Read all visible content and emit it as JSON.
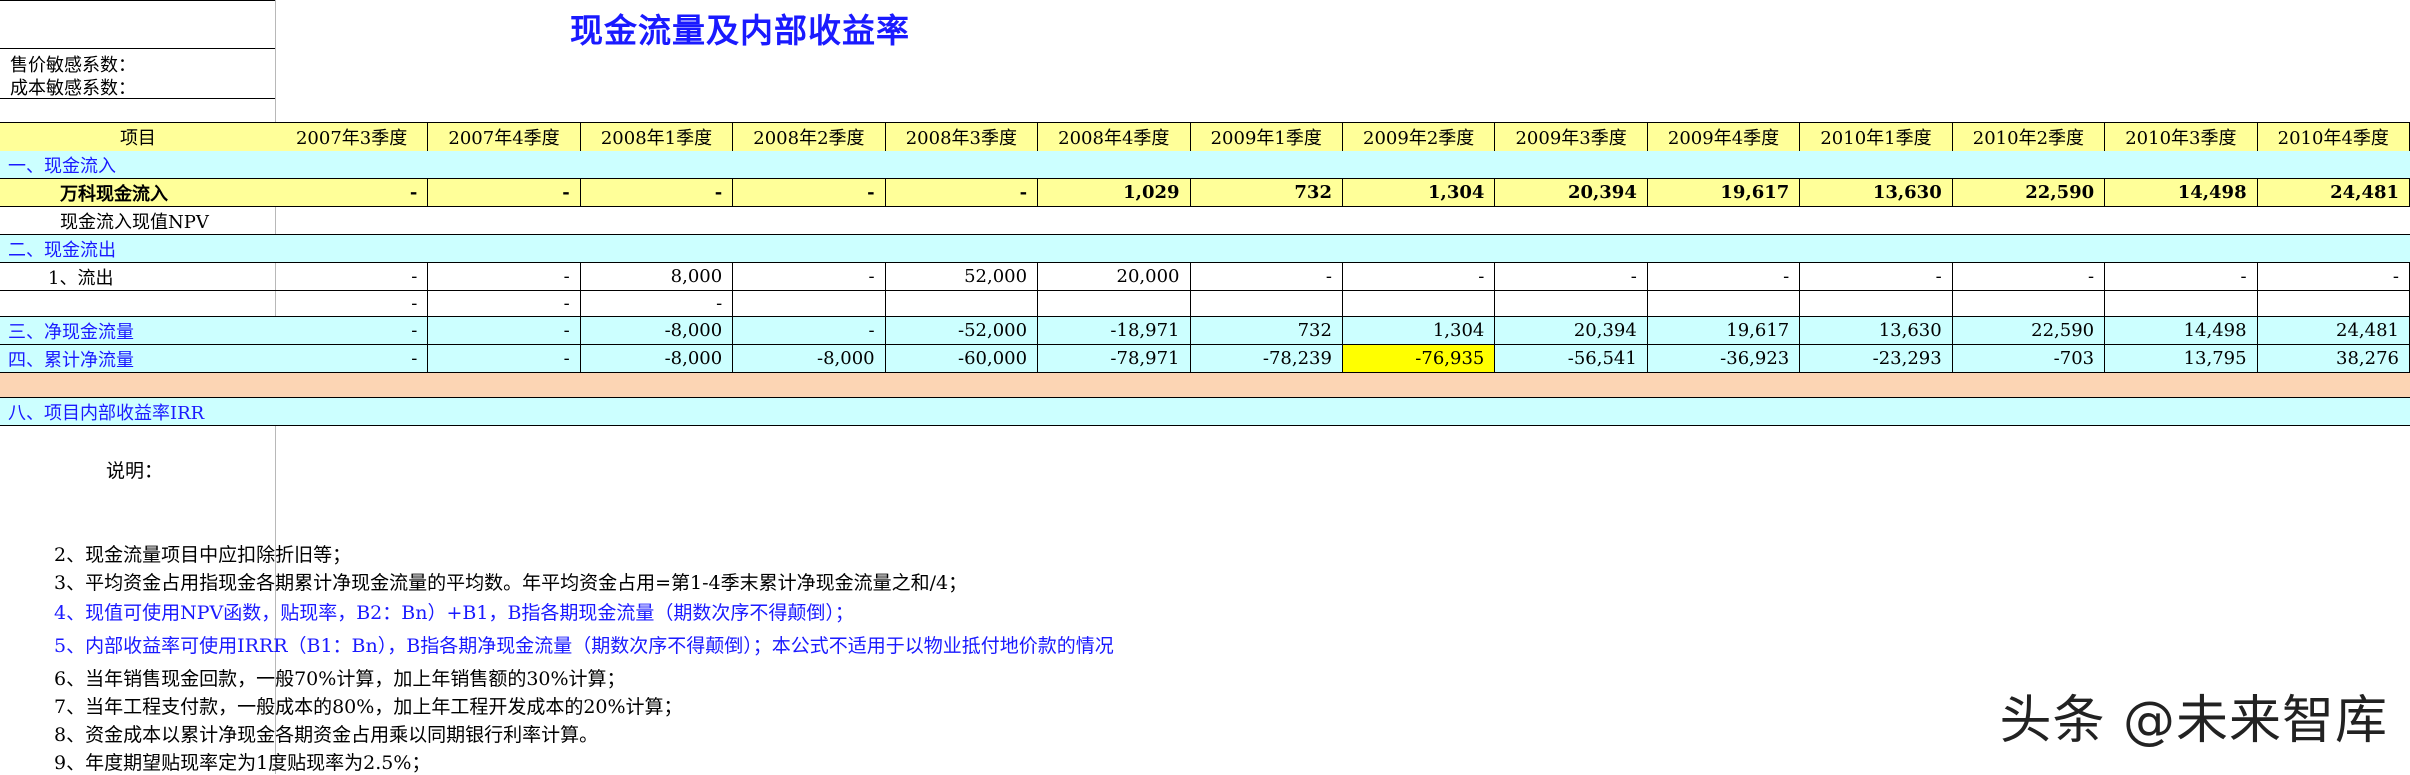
{
  "title": "现金流量及内部收益率",
  "side_labels": [
    "售价敏感系数：",
    "成本敏感系数："
  ],
  "header": {
    "item": "项目",
    "periods": [
      "2007年3季度",
      "2007年4季度",
      "2008年1季度",
      "2008年2季度",
      "2008年3季度",
      "2008年4季度",
      "2009年1季度",
      "2009年2季度",
      "2009年3季度",
      "2009年4季度",
      "2010年1季度",
      "2010年2季度",
      "2010年3季度",
      "2010年4季度"
    ]
  },
  "rows": [
    {
      "label": "一、现金流入",
      "values": []
    },
    {
      "label": "万科现金流入",
      "values": [
        "-",
        "-",
        "-",
        "-",
        "-",
        "1,029",
        "732",
        "1,304",
        "20,394",
        "19,617",
        "13,630",
        "22,590",
        "14,498",
        "24,481"
      ]
    },
    {
      "label": "现金流入现值NPV",
      "values": []
    },
    {
      "label": "二、现金流出",
      "values": []
    },
    {
      "label": "1、流出",
      "values": [
        "-",
        "-",
        "8,000",
        "-",
        "52,000",
        "20,000",
        "-",
        "-",
        "-",
        "-",
        "-",
        "-",
        "-",
        "-"
      ]
    },
    {
      "label": "",
      "values": [
        "-",
        "-",
        "-",
        "",
        "",
        "",
        "",
        "",
        "",
        "",
        "",
        "",
        "",
        ""
      ]
    },
    {
      "label": "三、净现金流量",
      "values": [
        "-",
        "-",
        "-8,000",
        "-",
        "-52,000",
        "-18,971",
        "732",
        "1,304",
        "20,394",
        "19,617",
        "13,630",
        "22,590",
        "14,498",
        "24,481"
      ]
    },
    {
      "label": "四、累计净流量",
      "values": [
        "-",
        "-",
        "-8,000",
        "-8,000",
        "-60,000",
        "-78,971",
        "-78,239",
        "-76,935",
        "-56,541",
        "-36,923",
        "-23,293",
        "-703",
        "13,795",
        "38,276"
      ]
    },
    {
      "label": "",
      "values": []
    },
    {
      "label": "八、项目内部收益率IRR",
      "values": []
    }
  ],
  "notes_title": "说明：",
  "notes": [
    "2、现金流量项目中应扣除折旧等；",
    "3、平均资金占用指现金各期累计净现金流量的平均数。年平均资金占用=第1-4季末累计净现金流量之和/4；",
    "4、现值可使用NPV函数，贴现率，B2：Bn）+B1，B指各期现金流量（期数次序不得颠倒）；",
    "5、内部收益率可使用IRRR（B1：Bn），B指各期净现金流量（期数次序不得颠倒）；本公式不适用于以物业抵付地价款的情况",
    "6、当年销售现金回款，一般70%计算，加上年销售额的30%计算；",
    "7、当年工程支付款，一般成本的80%，加上年工程开发成本的20%计算；",
    "8、资金成本以累计净现金各期资金占用乘以同期银行利率计算。",
    "9、年度期望贴现率定为1度贴现率为2.5%；"
  ],
  "watermark": "头条 @未来智库",
  "colors": {
    "blue": "#1a1aff",
    "cyan": "#ccffff",
    "yellow": "#ffff99",
    "orange": "#fcd5b4",
    "highlight": "#ffff00"
  }
}
